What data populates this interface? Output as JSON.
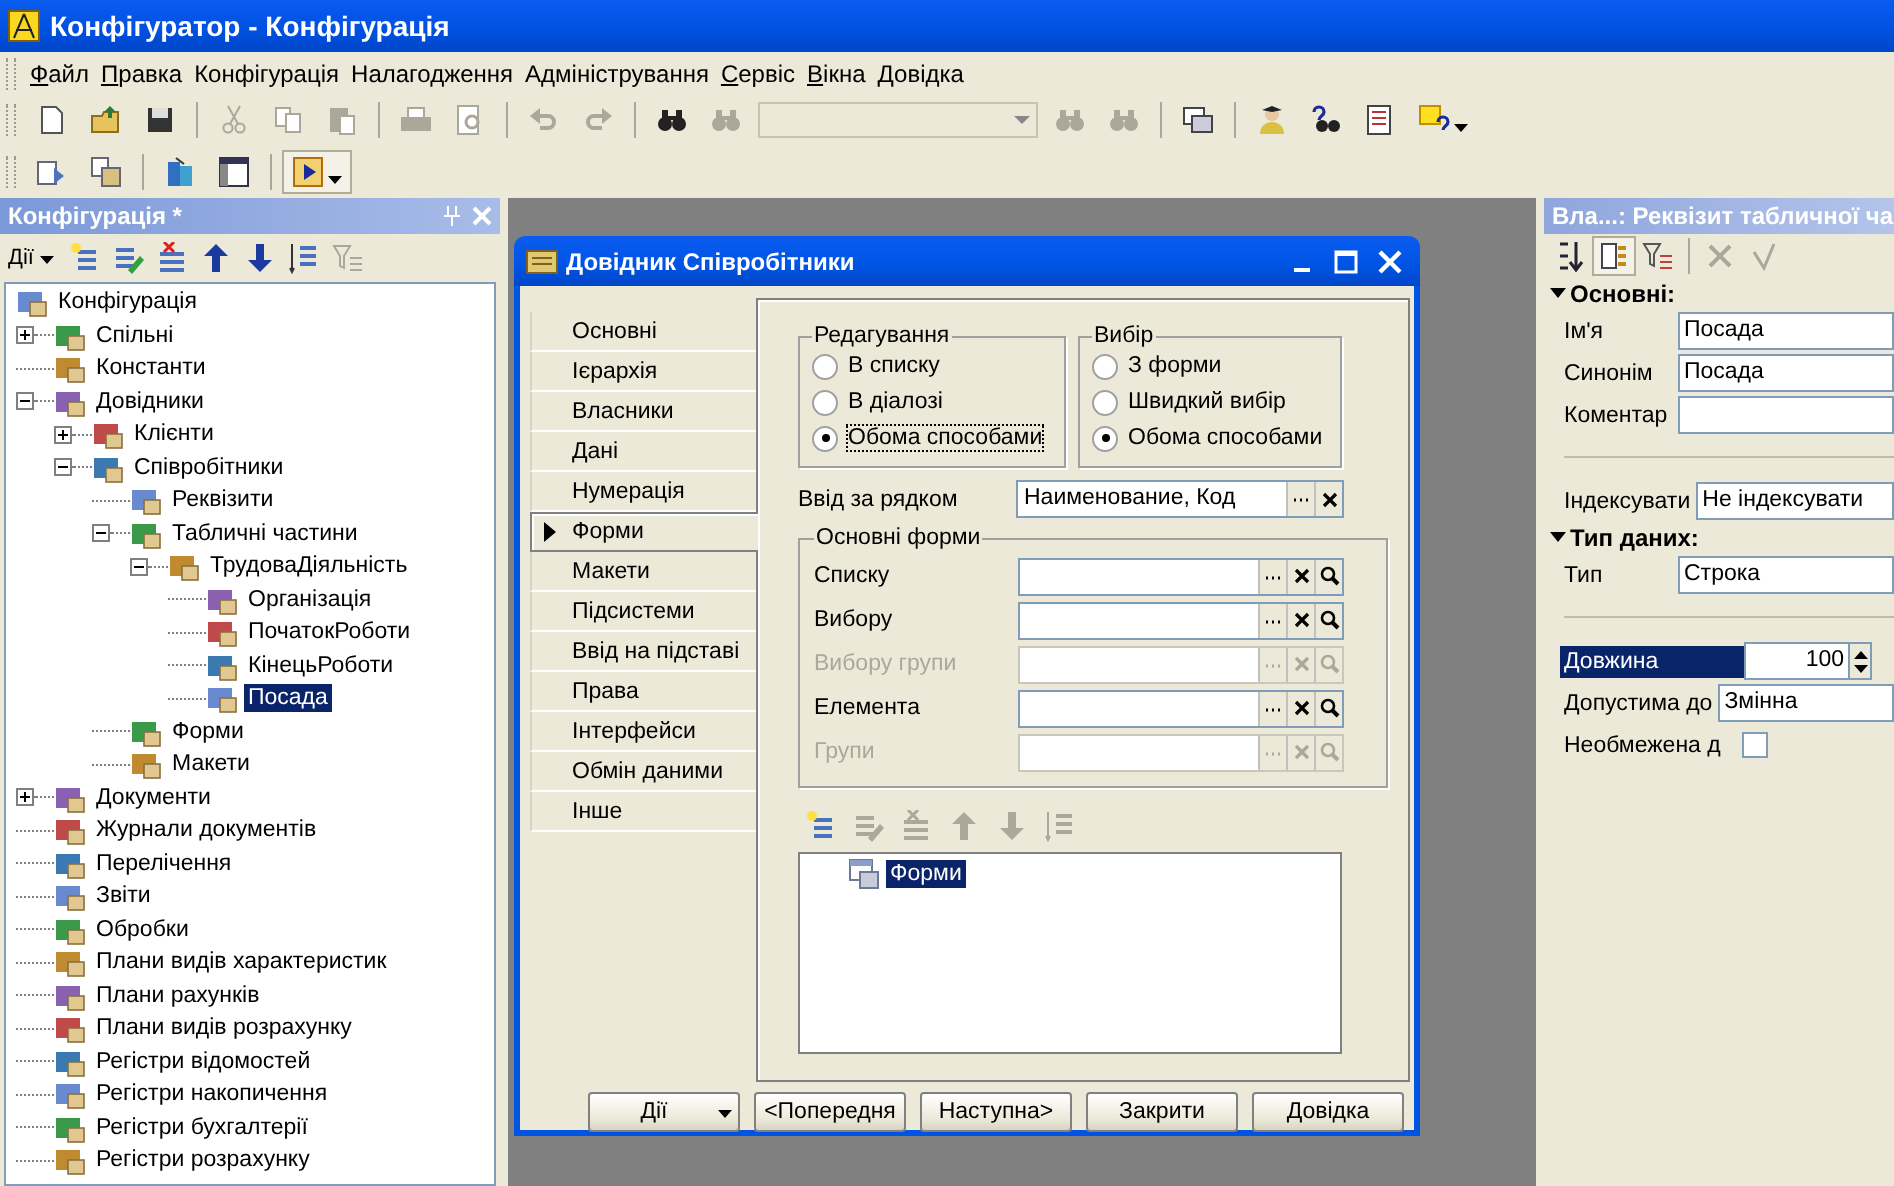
{
  "window": {
    "title": "Конфігуратор - Конфігурація"
  },
  "menu": [
    {
      "label": "Файл",
      "mnemonic": true
    },
    {
      "label": "Правка",
      "mnemonic": true
    },
    {
      "label": "Конфігурація",
      "mnemonic": false
    },
    {
      "label": "Налагодження",
      "mnemonic": false
    },
    {
      "label": "Адміністрування",
      "mnemonic": false
    },
    {
      "label": "Сервіс",
      "mnemonic": true
    },
    {
      "label": "Вікна",
      "mnemonic": true
    },
    {
      "label": "Довідка",
      "mnemonic": true
    }
  ],
  "toolbar_1": [
    {
      "disabled": false
    },
    {
      "disabled": false
    },
    {
      "disabled": false
    },
    {
      "disabled": true
    },
    {
      "disabled": true
    },
    {
      "disabled": true
    },
    {
      "disabled": true
    },
    {
      "disabled": true
    },
    {
      "disabled": true
    },
    {
      "disabled": true
    },
    {
      "disabled": false
    },
    {
      "disabled": true
    },
    {
      "disabled": true
    },
    {
      "disabled": true
    },
    {
      "disabled": false
    },
    {
      "disabled": false
    },
    {
      "disabled": false
    },
    {
      "disabled": false
    },
    {
      "disabled": false
    }
  ],
  "search_combo": {
    "disabled": true
  },
  "toolbar_2": [
    {
      "disabled": false
    },
    {
      "disabled": false
    },
    {
      "disabled": false
    },
    {
      "disabled": false
    },
    {
      "disabled": false
    }
  ],
  "config_panel": {
    "title": "Конфігурація *",
    "actions_label": "Дії",
    "toolbar": [
      {
        "disabled": false
      },
      {
        "disabled": false
      },
      {
        "disabled": false
      },
      {
        "disabled": false
      },
      {
        "disabled": false
      },
      {
        "disabled": false
      },
      {
        "disabled": true
      }
    ],
    "tree": [
      {
        "label": "Конфігурація",
        "selected": false,
        "children": [
          {
            "label": "Спільні",
            "selected": false,
            "expanded": false
          },
          {
            "label": "Константи",
            "selected": false
          },
          {
            "label": "Довідники",
            "selected": false,
            "expanded": true,
            "children": [
              {
                "label": "Клієнти",
                "selected": false,
                "expanded": false
              },
              {
                "label": "Співробітники",
                "selected": false,
                "expanded": true,
                "children": [
                  {
                    "label": "Реквізити",
                    "selected": false
                  },
                  {
                    "label": "Табличні частини",
                    "selected": false,
                    "expanded": true,
                    "children": [
                      {
                        "label": "ТрудоваДіяльність",
                        "selected": false,
                        "expanded": true,
                        "children": [
                          {
                            "label": "Організація",
                            "selected": false
                          },
                          {
                            "label": "ПочатокРоботи",
                            "selected": false
                          },
                          {
                            "label": "КінецьРоботи",
                            "selected": false
                          },
                          {
                            "label": "Посада",
                            "selected": true
                          }
                        ]
                      }
                    ]
                  },
                  {
                    "label": "Форми",
                    "selected": false
                  },
                  {
                    "label": "Макети",
                    "selected": false
                  }
                ]
              }
            ]
          },
          {
            "label": "Документи",
            "selected": false,
            "expanded": false
          },
          {
            "label": "Журнали документів",
            "selected": false
          },
          {
            "label": "Перелічення",
            "selected": false
          },
          {
            "label": "Звіти",
            "selected": false
          },
          {
            "label": "Обробки",
            "selected": false
          },
          {
            "label": "Плани видів характеристик",
            "selected": false
          },
          {
            "label": "Плани рахунків",
            "selected": false
          },
          {
            "label": "Плани видів розрахунку",
            "selected": false
          },
          {
            "label": "Регістри відомостей",
            "selected": false
          },
          {
            "label": "Регістри накопичення",
            "selected": false
          },
          {
            "label": "Регістри бухгалтерії",
            "selected": false
          },
          {
            "label": "Регістри розрахунку",
            "selected": false
          }
        ]
      }
    ]
  },
  "dialog": {
    "title": "Довідник Співробітники",
    "tabs": [
      {
        "label": "Основні",
        "selected": false
      },
      {
        "label": "Ієрархія",
        "selected": false
      },
      {
        "label": "Власники",
        "selected": false
      },
      {
        "label": "Дані",
        "selected": false
      },
      {
        "label": "Нумерація",
        "selected": false
      },
      {
        "label": "Форми",
        "selected": true
      },
      {
        "label": "Макети",
        "selected": false
      },
      {
        "label": "Підсистеми",
        "selected": false
      },
      {
        "label": "Ввід на підставі",
        "selected": false
      },
      {
        "label": "Права",
        "selected": false
      },
      {
        "label": "Інтерфейси",
        "selected": false
      },
      {
        "label": "Обмін даними",
        "selected": false
      },
      {
        "label": "Інше",
        "selected": false
      }
    ],
    "editing": {
      "title": "Редагування",
      "options": [
        {
          "label": "В списку",
          "selected": false,
          "focused": false
        },
        {
          "label": "В діалозі",
          "selected": false,
          "focused": false
        },
        {
          "label": "Обома способами",
          "selected": true,
          "focused": true
        }
      ]
    },
    "choice": {
      "title": "Вибір",
      "options": [
        {
          "label": "З форми",
          "selected": false,
          "focused": false
        },
        {
          "label": "Швидкий вибір",
          "selected": false,
          "focused": false
        },
        {
          "label": "Обома способами",
          "selected": true,
          "focused": false
        }
      ]
    },
    "line_input": {
      "label": "Ввід за рядком",
      "value": "Наименование, Код"
    },
    "main_forms": {
      "title": "Основні форми",
      "rows": [
        {
          "label": "Списку",
          "disabled": false
        },
        {
          "label": "Вибору",
          "disabled": false
        },
        {
          "label": "Вибору групи",
          "disabled": true
        },
        {
          "label": "Елемента",
          "disabled": false
        },
        {
          "label": "Групи",
          "disabled": true
        }
      ]
    },
    "forms_toolbar": [
      {
        "disabled": false
      },
      {
        "disabled": true
      },
      {
        "disabled": true
      },
      {
        "disabled": true
      },
      {
        "disabled": true
      },
      {
        "disabled": true
      }
    ],
    "forms_list": [
      {
        "label": "Форми",
        "selected": true
      }
    ],
    "buttons": [
      {
        "label": "Дії",
        "kind": "menu"
      },
      {
        "label": "<Попередня",
        "kind": "plain"
      },
      {
        "label": "Наступна>",
        "kind": "plain"
      },
      {
        "label": "Закрити",
        "kind": "plain"
      },
      {
        "label": "Довідка",
        "kind": "plain"
      }
    ]
  },
  "properties": {
    "title": "Вла...: Реквізит табличної ча",
    "toolbar": [
      {
        "disabled": false
      },
      {
        "disabled": false
      },
      {
        "disabled": false
      },
      {
        "disabled": true
      },
      {
        "disabled": true
      }
    ],
    "sections": [
      {
        "title": "Основні:",
        "expanded": true,
        "rows": [
          {
            "kind": "text",
            "label": "Ім'я",
            "value": "Посада",
            "selected": false
          },
          {
            "kind": "text",
            "label": "Синонім",
            "value": "Посада",
            "selected": false
          },
          {
            "kind": "text",
            "label": "Коментар",
            "value": "",
            "selected": false
          },
          {
            "kind": "separator"
          },
          {
            "kind": "text",
            "label": "Індексувати",
            "value": "Не індексувати",
            "selected": false
          }
        ]
      },
      {
        "title": "Тип даних:",
        "expanded": true,
        "rows": [
          {
            "kind": "text",
            "label": "Тип",
            "value": "Строка",
            "selected": false
          },
          {
            "kind": "separator"
          },
          {
            "kind": "number",
            "label": "Довжина",
            "value": "100",
            "selected": true
          },
          {
            "kind": "text",
            "label": "Допустима до",
            "value": "Змінна",
            "selected": false
          },
          {
            "kind": "checkbox",
            "label": "Необмежена д",
            "checked": false,
            "selected": false
          }
        ]
      }
    ]
  }
}
